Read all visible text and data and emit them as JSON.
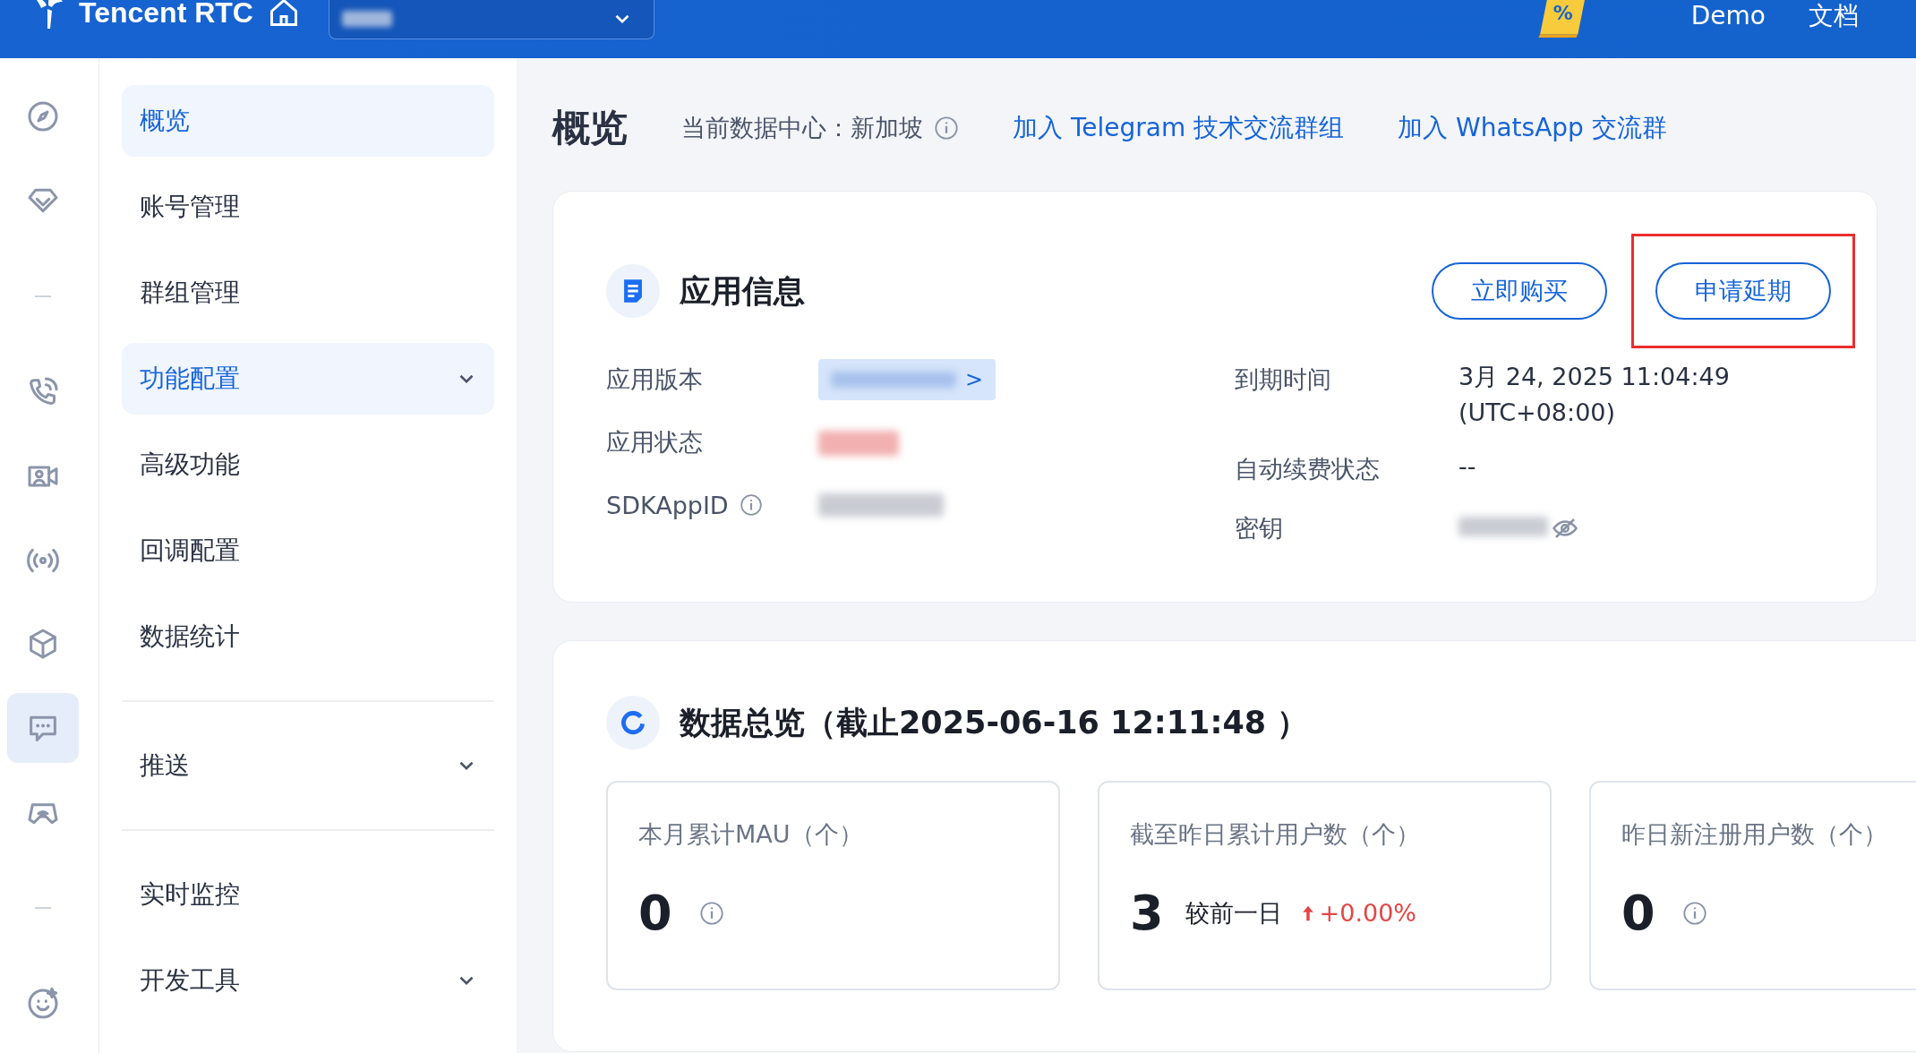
{
  "topbar": {
    "brand": "Tencent RTC",
    "promo_mark": "%",
    "links": [
      "Demo",
      "文档"
    ]
  },
  "rail": [
    {
      "kind": "compass",
      "selected": false
    },
    {
      "kind": "diamond",
      "selected": false
    },
    {
      "kind": "separator"
    },
    {
      "kind": "phone",
      "selected": false
    },
    {
      "kind": "video",
      "selected": false
    },
    {
      "kind": "broadcast",
      "selected": false
    },
    {
      "kind": "cube",
      "selected": false
    },
    {
      "kind": "chat",
      "selected": true
    },
    {
      "kind": "gamepad",
      "selected": false
    },
    {
      "kind": "separator"
    },
    {
      "kind": "smile",
      "selected": false
    }
  ],
  "sidebar": {
    "groups": [
      {
        "items": [
          {
            "label": "概览",
            "selected": true,
            "expandable": false
          },
          {
            "label": "账号管理",
            "selected": false,
            "expandable": false
          },
          {
            "label": "群组管理",
            "selected": false,
            "expandable": false
          },
          {
            "label": "功能配置",
            "selected": true,
            "expandable": true
          },
          {
            "label": "高级功能",
            "selected": false,
            "expandable": false
          },
          {
            "label": "回调配置",
            "selected": false,
            "expandable": false
          },
          {
            "label": "数据统计",
            "selected": false,
            "expandable": false
          }
        ]
      },
      {
        "items": [
          {
            "label": "推送",
            "selected": false,
            "expandable": true
          }
        ]
      },
      {
        "items": [
          {
            "label": "实时监控",
            "selected": false,
            "expandable": false
          },
          {
            "label": "开发工具",
            "selected": false,
            "expandable": true
          }
        ]
      }
    ]
  },
  "page": {
    "title": "概览",
    "datacenter_label": "当前数据中心：",
    "datacenter_value": "新加坡",
    "links": [
      "加入 Telegram 技术交流群组",
      "加入 WhatsApp 交流群"
    ]
  },
  "app_info": {
    "title": "应用信息",
    "buttons": [
      {
        "label": "立即购买",
        "highlighted": false
      },
      {
        "label": "申请延期",
        "highlighted": true
      }
    ],
    "left_fields": [
      {
        "label": "应用版本",
        "kind": "redacted-link",
        "mark": ">",
        "info": false
      },
      {
        "label": "应用状态",
        "kind": "redacted-status",
        "info": false
      },
      {
        "label": "SDKAppID",
        "kind": "redacted-copy",
        "info": true
      }
    ],
    "right_fields": [
      {
        "label": "到期时间",
        "kind": "text",
        "lines": [
          "3月 24, 2025 11:04:49",
          "(UTC+08:00)"
        ]
      },
      {
        "label": "自动续费状态",
        "kind": "text",
        "lines": [
          "--"
        ]
      },
      {
        "label": "密钥",
        "kind": "redacted-secret"
      }
    ]
  },
  "data_overview": {
    "title": "数据总览（截止2025-06-16 12:11:48 ）",
    "stats": [
      {
        "label": "本月累计MAU（个）",
        "value": "0",
        "info": true
      },
      {
        "label": "截至昨日累计用户数（个）",
        "value": "3",
        "info": false,
        "compare_label": "较前一日",
        "trend_up": true,
        "change": "+0.00%"
      },
      {
        "label": "昨日新注册用户数（个）",
        "value": "0",
        "info": true
      }
    ]
  }
}
